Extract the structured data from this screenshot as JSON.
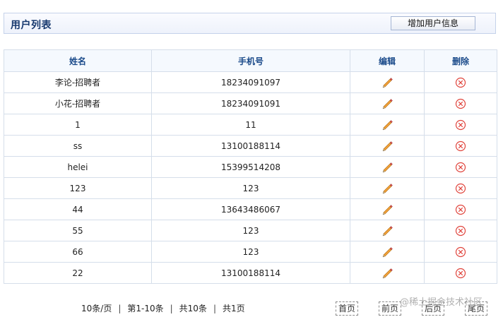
{
  "header": {
    "title": "用户列表",
    "add_button_label": "增加用户信息"
  },
  "table": {
    "columns": [
      "姓名",
      "手机号",
      "编辑",
      "删除"
    ],
    "rows": [
      {
        "name": "李论-招聘者",
        "phone": "18234091097"
      },
      {
        "name": "小花-招聘者",
        "phone": "18234091091"
      },
      {
        "name": "1",
        "phone": "11"
      },
      {
        "name": "ss",
        "phone": "13100188114"
      },
      {
        "name": "helei",
        "phone": "15399514208"
      },
      {
        "name": "123",
        "phone": "123"
      },
      {
        "name": "44",
        "phone": "13643486067"
      },
      {
        "name": "55",
        "phone": "123"
      },
      {
        "name": "66",
        "phone": "123"
      },
      {
        "name": "22",
        "phone": "13100188114"
      }
    ],
    "edit_icon": "pencil-icon",
    "delete_icon": "circle-x-icon",
    "delete_color": "#e0443c"
  },
  "pagination": {
    "per_page": "10条/页",
    "range": "第1-10条",
    "total_records": "共10条",
    "total_pages": "共1页",
    "separator": "|",
    "first": "首页",
    "prev": "前页",
    "next": "后页",
    "last": "尾页"
  },
  "watermark": "@稀土掘金技术社区"
}
